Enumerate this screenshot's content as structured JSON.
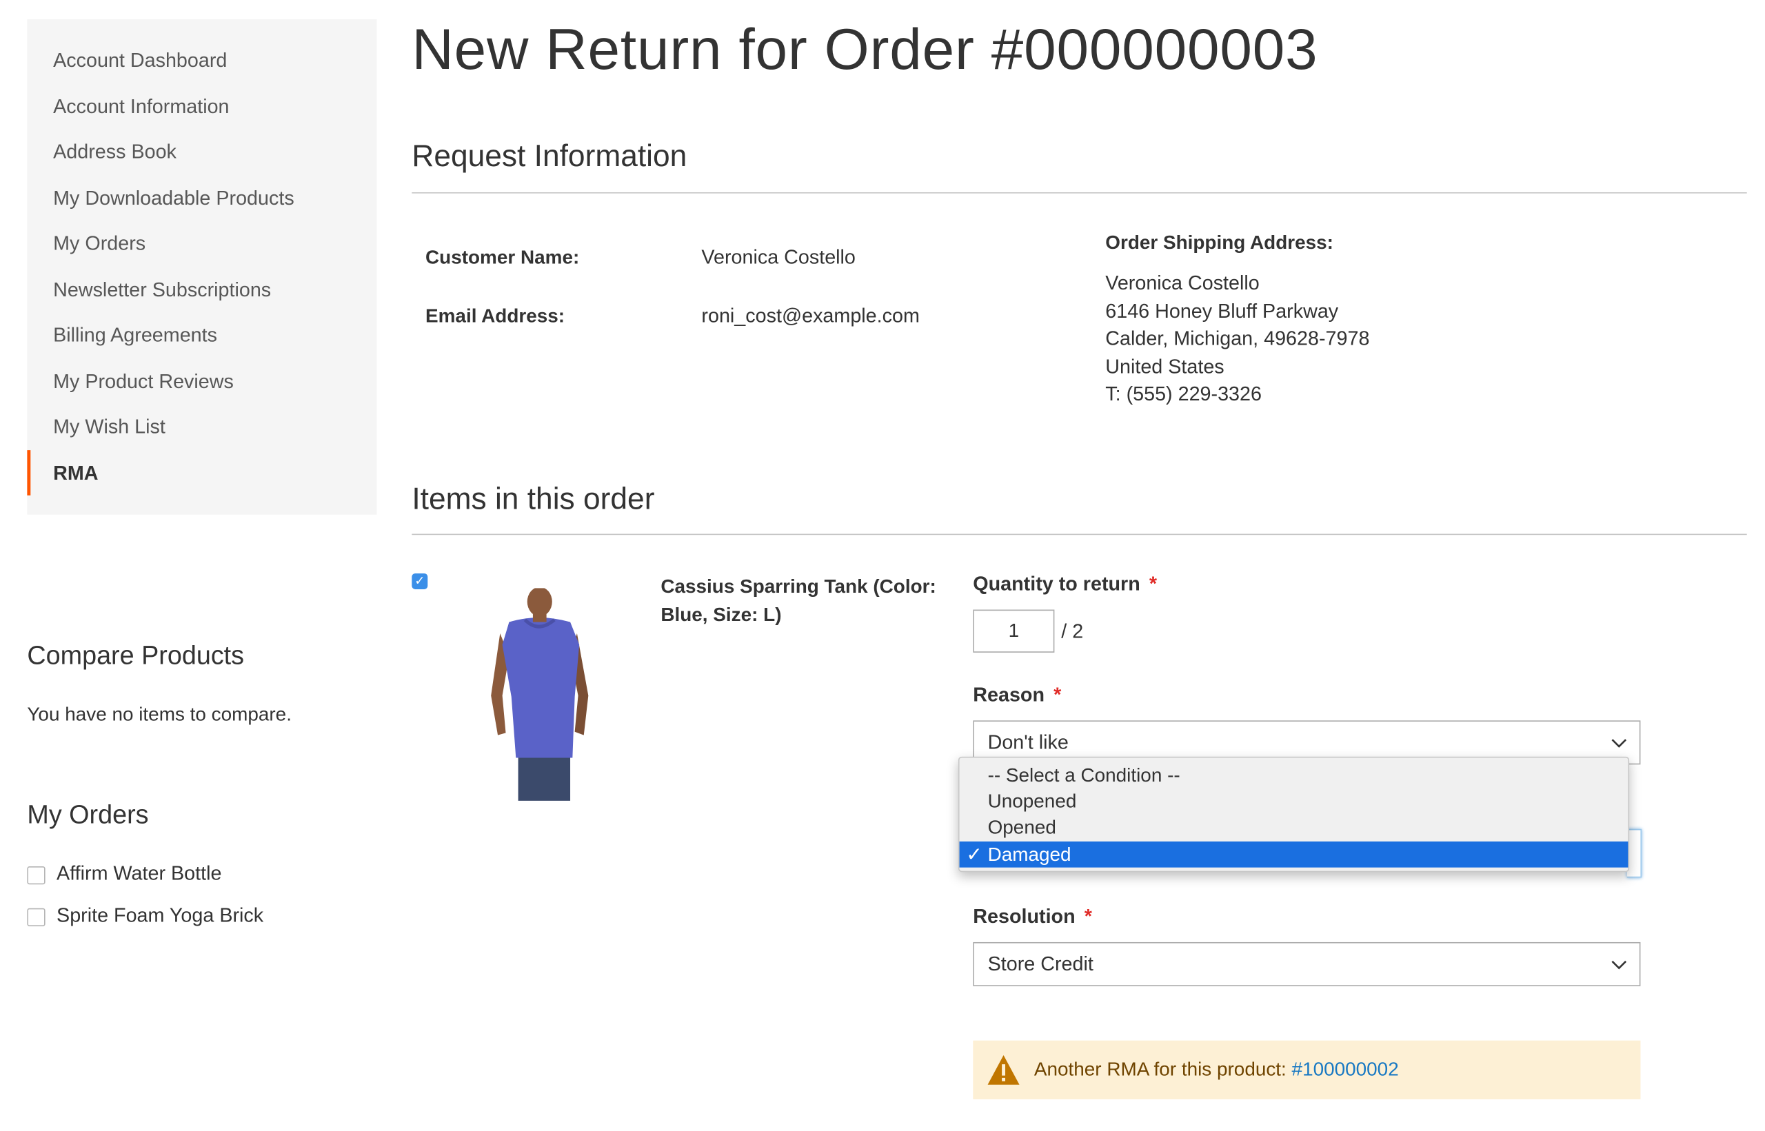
{
  "sidebar": {
    "items": [
      {
        "label": "Account Dashboard"
      },
      {
        "label": "Account Information"
      },
      {
        "label": "Address Book"
      },
      {
        "label": "My Downloadable Products"
      },
      {
        "label": "My Orders"
      },
      {
        "label": "Newsletter Subscriptions"
      },
      {
        "label": "Billing Agreements"
      },
      {
        "label": "My Product Reviews"
      },
      {
        "label": "My Wish List"
      },
      {
        "label": "RMA",
        "active": true
      }
    ],
    "accent_color": "#ff5501"
  },
  "compare": {
    "title": "Compare Products",
    "empty_text": "You have no items to compare."
  },
  "my_orders": {
    "title": "My Orders",
    "items": [
      {
        "label": "Affirm Water Bottle"
      },
      {
        "label": "Sprite Foam Yoga Brick"
      }
    ]
  },
  "page": {
    "title": "New Return for Order #000000003"
  },
  "request": {
    "title": "Request Information",
    "customer_name_label": "Customer Name:",
    "customer_name": "Veronica Costello",
    "email_label": "Email Address:",
    "email": "roni_cost@example.com",
    "shipping_label": "Order Shipping Address:",
    "address": {
      "line1": "Veronica Costello",
      "line2": "6146 Honey Bluff Parkway",
      "line3": "Calder, Michigan, 49628-7978",
      "line4": "United States",
      "line5": "T: (555) 229-3326"
    }
  },
  "items": {
    "title": "Items in this order",
    "product_name": "Cassius Sparring Tank (Color: Blue, Size: L)",
    "checked": true,
    "qty_label": "Quantity to return",
    "qty_value": "1",
    "qty_total": "/ 2",
    "reason_label": "Reason",
    "reason_value": "Don't like",
    "condition_options": [
      {
        "label": "-- Select a Condition --"
      },
      {
        "label": "Unopened"
      },
      {
        "label": "Opened"
      },
      {
        "label": "Damaged",
        "selected": true
      }
    ],
    "selected_tick": "✓",
    "resolution_label": "Resolution",
    "resolution_value": "Store Credit",
    "required_marker": "*"
  },
  "notice": {
    "text": "Another RMA for this product: ",
    "link": "#100000002",
    "icon": "warning-icon"
  },
  "colors": {
    "selected_option": "#1a6fe0",
    "notice_bg": "#fdf0d5",
    "link": "#1979c3",
    "required": "#e02b27"
  }
}
